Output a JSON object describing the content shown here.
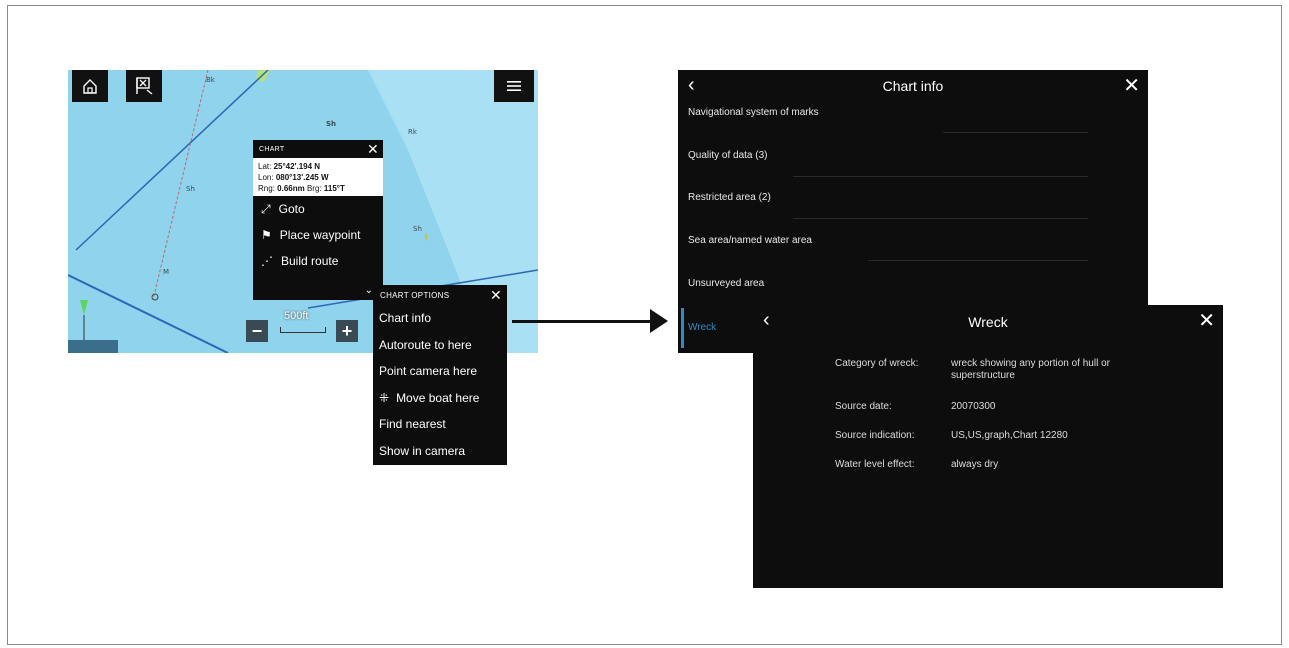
{
  "chart_screen": {
    "toolbar": {
      "home_icon": "home-icon",
      "waypoint_icon": "waypoint-flag-icon",
      "menu_icon": "hamburger-menu-icon"
    },
    "map_labels": [
      {
        "text": "Bk",
        "name": "map-label-bk"
      },
      {
        "text": "Sh",
        "name": "map-label-sh"
      },
      {
        "text": "Rk",
        "name": "map-label-rk"
      },
      {
        "text": "Sh",
        "name": "map-label-sh-2"
      },
      {
        "text": "Sh",
        "name": "map-label-sh-3"
      },
      {
        "text": "M",
        "name": "map-label-m"
      }
    ],
    "chart_popup": {
      "header": "CHART",
      "lat_label": "Lat:",
      "lat_value": "25°42'.194 N",
      "lon_label": "Lon:",
      "lon_value": "080°13'.245 W",
      "rng_label": "Rng:",
      "rng_value": "0.66nm",
      "brg_label": "Brg:",
      "brg_value": "115°T",
      "items": [
        "Goto",
        "Place waypoint",
        "Build route"
      ]
    },
    "options_popup": {
      "header": "CHART OPTIONS",
      "items": [
        "Chart info",
        "Autoroute to here",
        "Point camera here",
        "Move boat here",
        "Find nearest",
        "Show in camera"
      ]
    },
    "scale": "500ft"
  },
  "chart_info": {
    "title": "Chart info",
    "rows": [
      "Navigational system of marks",
      "Quality of data (3)",
      "Restricted area (2)",
      "Sea area/named water area",
      "Unsurveyed area",
      "Wreck"
    ]
  },
  "wreck": {
    "title": "Wreck",
    "fields": [
      {
        "label": "Category of wreck:",
        "value": "wreck showing any portion of hull or superstructure"
      },
      {
        "label": "Source date:",
        "value": "20070300"
      },
      {
        "label": "Source indication:",
        "value": "US,US,graph,Chart 12280"
      },
      {
        "label": "Water level effect:",
        "value": "always dry"
      }
    ]
  },
  "colors": {
    "sea": "#8fd3ec",
    "panel": "#0d0d0d",
    "accent": "#2b8cc7",
    "land": "#e9e37a"
  }
}
